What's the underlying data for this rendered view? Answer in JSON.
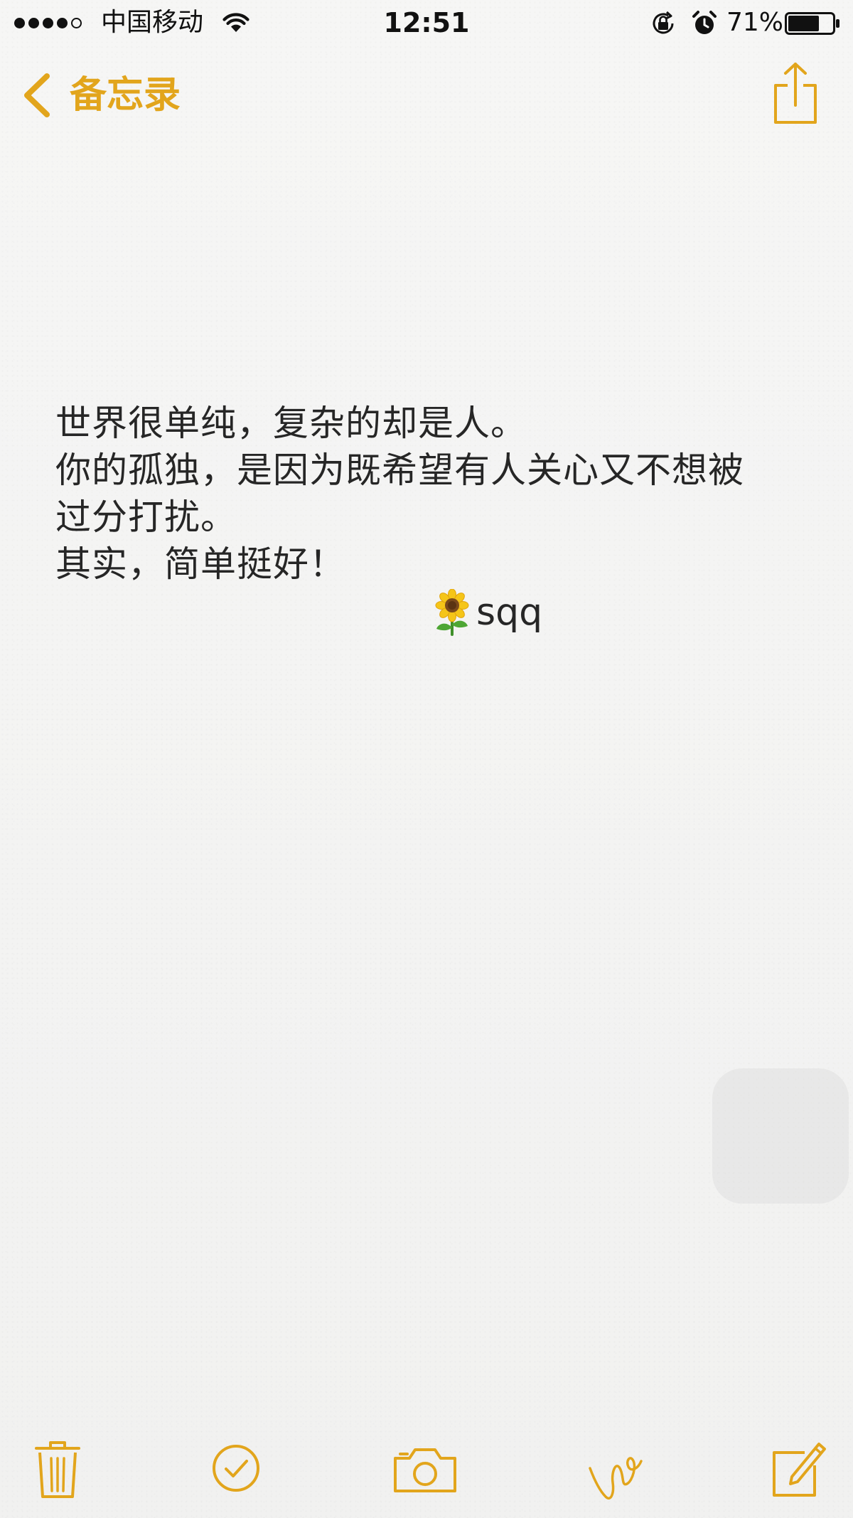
{
  "colors": {
    "accent": "#e2a51c",
    "text": "#262626",
    "status_text": "#111111"
  },
  "status_bar": {
    "signal_filled": 4,
    "signal_total": 5,
    "carrier": "中国移动",
    "time": "12:51",
    "battery_percent": "71%",
    "battery_level": 0.71,
    "icons": [
      "wifi-icon",
      "rotation-lock-icon",
      "alarm-icon",
      "battery-icon"
    ]
  },
  "nav": {
    "back_label": "备忘录",
    "icons": [
      "chevron-left-icon",
      "share-icon"
    ]
  },
  "note": {
    "lines": [
      "世界很单纯，复杂的却是人。",
      "你的孤独，是因为既希望有人关心又不想被",
      "过分打扰。",
      "其实，简单挺好！"
    ],
    "signature": "sqq",
    "signature_icon": "sunflower-icon"
  },
  "toolbar": {
    "icons": [
      "trash-icon",
      "checklist-icon",
      "camera-icon",
      "sketch-icon",
      "compose-icon"
    ]
  }
}
